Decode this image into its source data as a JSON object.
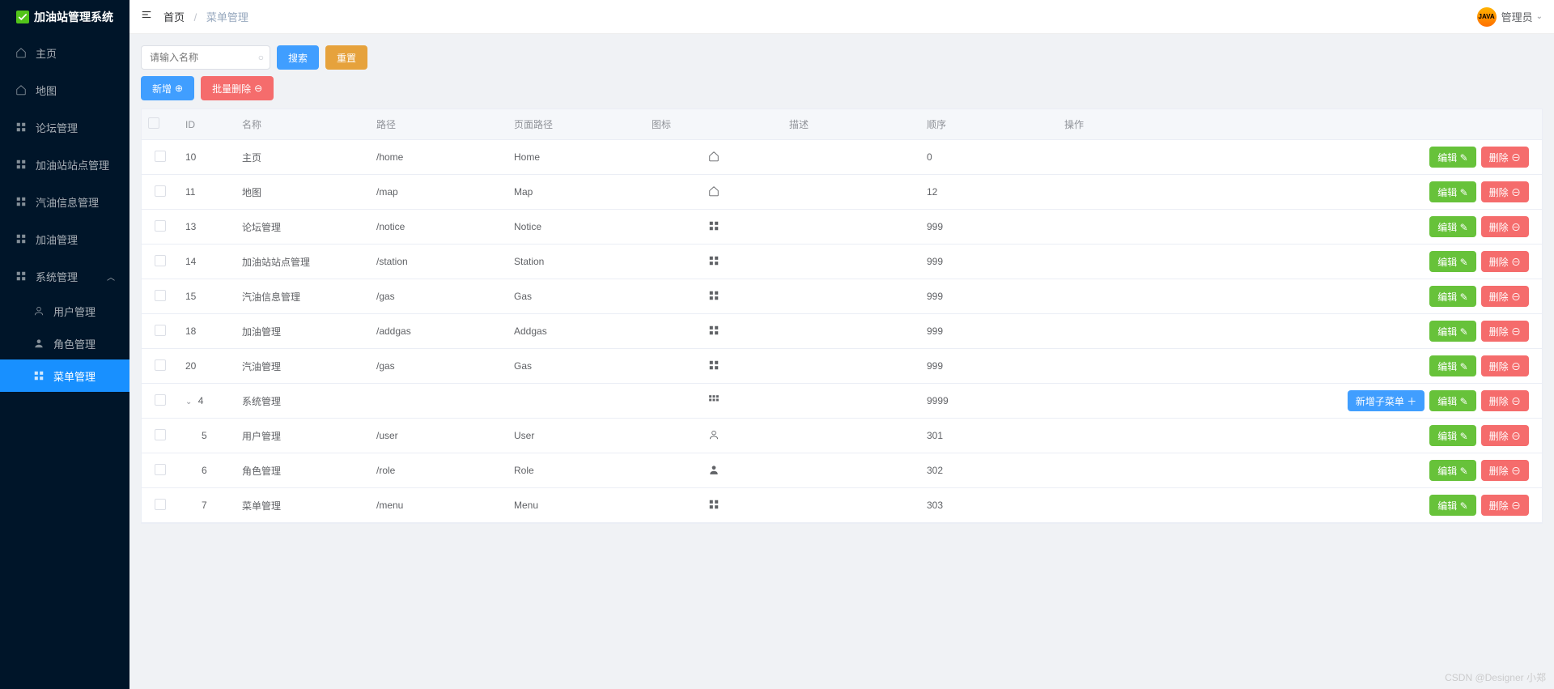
{
  "app": {
    "title": "加油站管理系统"
  },
  "sidebar": {
    "items": [
      {
        "label": "主页",
        "icon": "home"
      },
      {
        "label": "地图",
        "icon": "home"
      },
      {
        "label": "论坛管理",
        "icon": "grid"
      },
      {
        "label": "加油站站点管理",
        "icon": "grid"
      },
      {
        "label": "汽油信息管理",
        "icon": "grid"
      },
      {
        "label": "加油管理",
        "icon": "grid"
      },
      {
        "label": "系统管理",
        "icon": "grid",
        "expanded": true
      }
    ],
    "subitems": [
      {
        "label": "用户管理",
        "icon": "user"
      },
      {
        "label": "角色管理",
        "icon": "user"
      },
      {
        "label": "菜单管理",
        "icon": "grid",
        "active": true
      }
    ]
  },
  "header": {
    "breadcrumb_home": "首页",
    "breadcrumb_current": "菜单管理",
    "user": "管理员",
    "avatar_text": "JAVA"
  },
  "toolbar": {
    "search_placeholder": "请输入名称",
    "search_btn": "搜索",
    "reset_btn": "重置",
    "add_btn": "新增",
    "batch_delete_btn": "批量删除"
  },
  "table": {
    "headers": {
      "id": "ID",
      "name": "名称",
      "path": "路径",
      "page": "页面路径",
      "icon": "图标",
      "desc": "描述",
      "order": "顺序",
      "op": "操作"
    },
    "edit_btn": "编辑",
    "delete_btn": "删除",
    "add_child_btn": "新增子菜单",
    "rows": [
      {
        "id": "10",
        "name": "主页",
        "path": "/home",
        "page": "Home",
        "icon": "home",
        "desc": "",
        "order": "0",
        "child": false
      },
      {
        "id": "11",
        "name": "地图",
        "path": "/map",
        "page": "Map",
        "icon": "home",
        "desc": "",
        "order": "12",
        "child": false
      },
      {
        "id": "13",
        "name": "论坛管理",
        "path": "/notice",
        "page": "Notice",
        "icon": "grid",
        "desc": "",
        "order": "999",
        "child": false
      },
      {
        "id": "14",
        "name": "加油站站点管理",
        "path": "/station",
        "page": "Station",
        "icon": "grid",
        "desc": "",
        "order": "999",
        "child": false
      },
      {
        "id": "15",
        "name": "汽油信息管理",
        "path": "/gas",
        "page": "Gas",
        "icon": "grid",
        "desc": "",
        "order": "999",
        "child": false
      },
      {
        "id": "18",
        "name": "加油管理",
        "path": "/addgas",
        "page": "Addgas",
        "icon": "grid",
        "desc": "",
        "order": "999",
        "child": false
      },
      {
        "id": "20",
        "name": "汽油管理",
        "path": "/gas",
        "page": "Gas",
        "icon": "grid",
        "desc": "",
        "order": "999",
        "child": false
      },
      {
        "id": "4",
        "name": "系统管理",
        "path": "",
        "page": "",
        "icon": "grid4",
        "desc": "",
        "order": "9999",
        "expandable": true,
        "hasAddChild": true
      },
      {
        "id": "5",
        "name": "用户管理",
        "path": "/user",
        "page": "User",
        "icon": "user",
        "desc": "",
        "order": "301",
        "child": true
      },
      {
        "id": "6",
        "name": "角色管理",
        "path": "/role",
        "page": "Role",
        "icon": "userfill",
        "desc": "",
        "order": "302",
        "child": true
      },
      {
        "id": "7",
        "name": "菜单管理",
        "path": "/menu",
        "page": "Menu",
        "icon": "grid",
        "desc": "",
        "order": "303",
        "child": true
      }
    ]
  },
  "watermark": "CSDN @Designer 小郑"
}
